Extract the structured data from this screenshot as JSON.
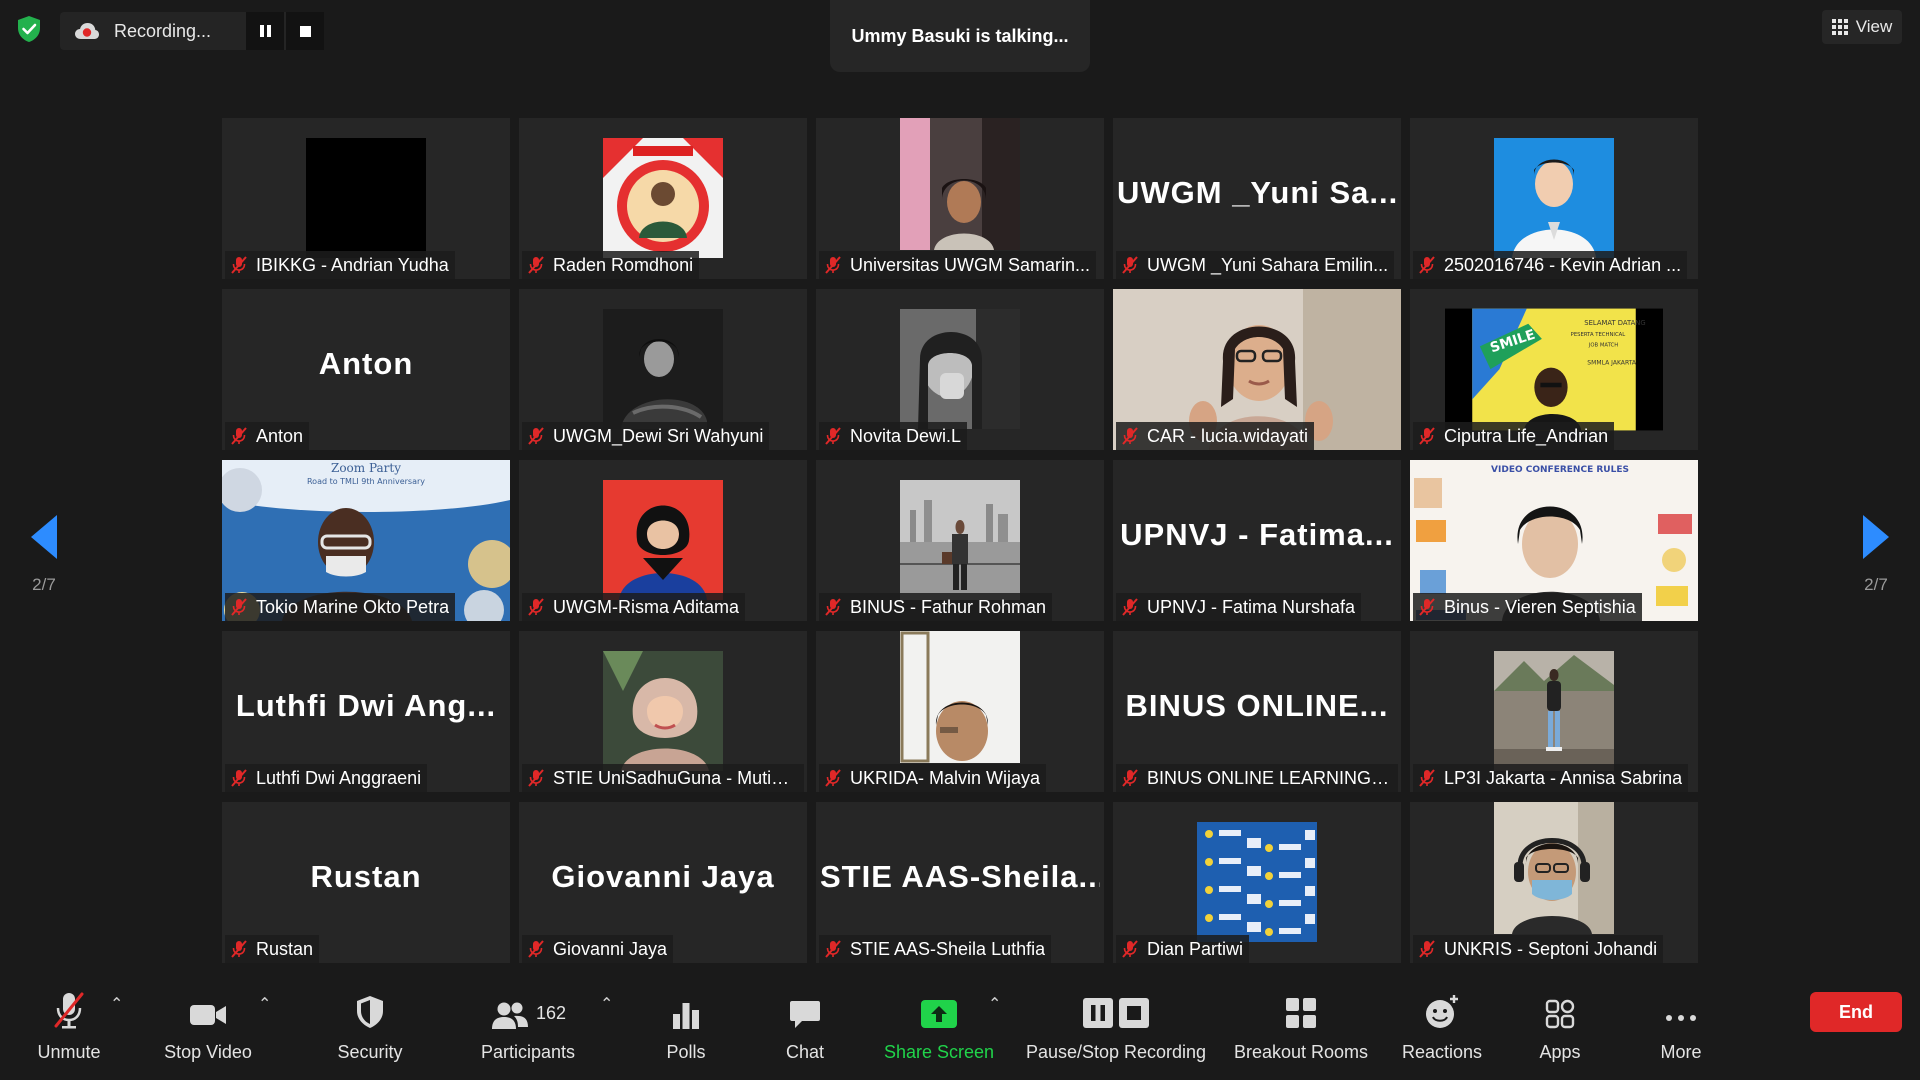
{
  "top": {
    "recording_label": "Recording...",
    "talking": "Ummy Basuki is talking...",
    "view_label": "View"
  },
  "pagination": {
    "left": "2/7",
    "right": "2/7"
  },
  "tiles": [
    {
      "label": "IBIKKG - Andrian Yudha",
      "kind": "photo",
      "desc": "black"
    },
    {
      "label": "Raden Romdhoni",
      "kind": "photo",
      "desc": "red-badge"
    },
    {
      "label": "Universitas UWGM Samarin...",
      "kind": "photo",
      "desc": "woman-pink"
    },
    {
      "label": "UWGM _Yuni Sahara Emilin...",
      "kind": "bigname",
      "big": "UWGM _Yuni Sa..."
    },
    {
      "label": "2502016746 - Kevin Adrian ...",
      "kind": "photo",
      "desc": "blue-portrait"
    },
    {
      "label": "Anton",
      "kind": "bigname",
      "big": "Anton"
    },
    {
      "label": "UWGM_Dewi Sri Wahyuni",
      "kind": "photo",
      "desc": "dark-bw"
    },
    {
      "label": "Novita Dewi.L",
      "kind": "photo",
      "desc": "gray-bw"
    },
    {
      "label": "CAR - lucia.widayati",
      "kind": "photo",
      "desc": "woman-hearts"
    },
    {
      "label": "Ciputra Life_Andrian",
      "kind": "photo",
      "desc": "yellow-banner"
    },
    {
      "label": "Tokio Marine Okto Petra",
      "kind": "photo",
      "desc": "zoom-party"
    },
    {
      "label": "UWGM-Risma Aditama",
      "kind": "photo",
      "desc": "red-hijab"
    },
    {
      "label": "BINUS - Fathur Rohman",
      "kind": "photo",
      "desc": "city-man"
    },
    {
      "label": "UPNVJ - Fatima Nurshafa",
      "kind": "bigname",
      "big": "UPNVJ - Fatima..."
    },
    {
      "label": "Binus - Vieren Septishia",
      "kind": "photo",
      "desc": "vc-rules"
    },
    {
      "label": "Luthfi Dwi Anggraeni",
      "kind": "bigname",
      "big": "Luthfi Dwi Ang..."
    },
    {
      "label": "STIE UniSadhuGuna - Mutia ...",
      "kind": "photo",
      "desc": "hijab-selfie"
    },
    {
      "label": "UKRIDA- Malvin Wijaya",
      "kind": "photo",
      "desc": "man-white"
    },
    {
      "label": "BINUS ONLINE LEARNING - ...",
      "kind": "bigname",
      "big": "BINUS ONLINE..."
    },
    {
      "label": "LP3I Jakarta - Annisa Sabrina",
      "kind": "photo",
      "desc": "street-woman"
    },
    {
      "label": "Rustan",
      "kind": "bigname",
      "big": "Rustan"
    },
    {
      "label": "Giovanni Jaya",
      "kind": "bigname",
      "big": "Giovanni Jaya"
    },
    {
      "label": "STIE AAS-Sheila Luthfia",
      "kind": "bigname",
      "big": "STIE AAS-Sheila..."
    },
    {
      "label": "Dian Partiwi",
      "kind": "photo",
      "desc": "blue-pattern"
    },
    {
      "label": "UNKRIS - Septoni Johandi",
      "kind": "photo",
      "desc": "masked-man"
    }
  ],
  "toolbar": {
    "unmute": "Unmute",
    "stop_video": "Stop Video",
    "security": "Security",
    "participants": "Participants",
    "participants_count": "162",
    "polls": "Polls",
    "chat": "Chat",
    "share_screen": "Share Screen",
    "pause_stop_recording": "Pause/Stop Recording",
    "breakout_rooms": "Breakout Rooms",
    "reactions": "Reactions",
    "apps": "Apps",
    "more": "More",
    "end": "End"
  },
  "colors": {
    "accent": "#2d8cff",
    "share": "#20d34a",
    "end": "#e02828",
    "mic_off": "#e02828",
    "tile": "#262626"
  }
}
